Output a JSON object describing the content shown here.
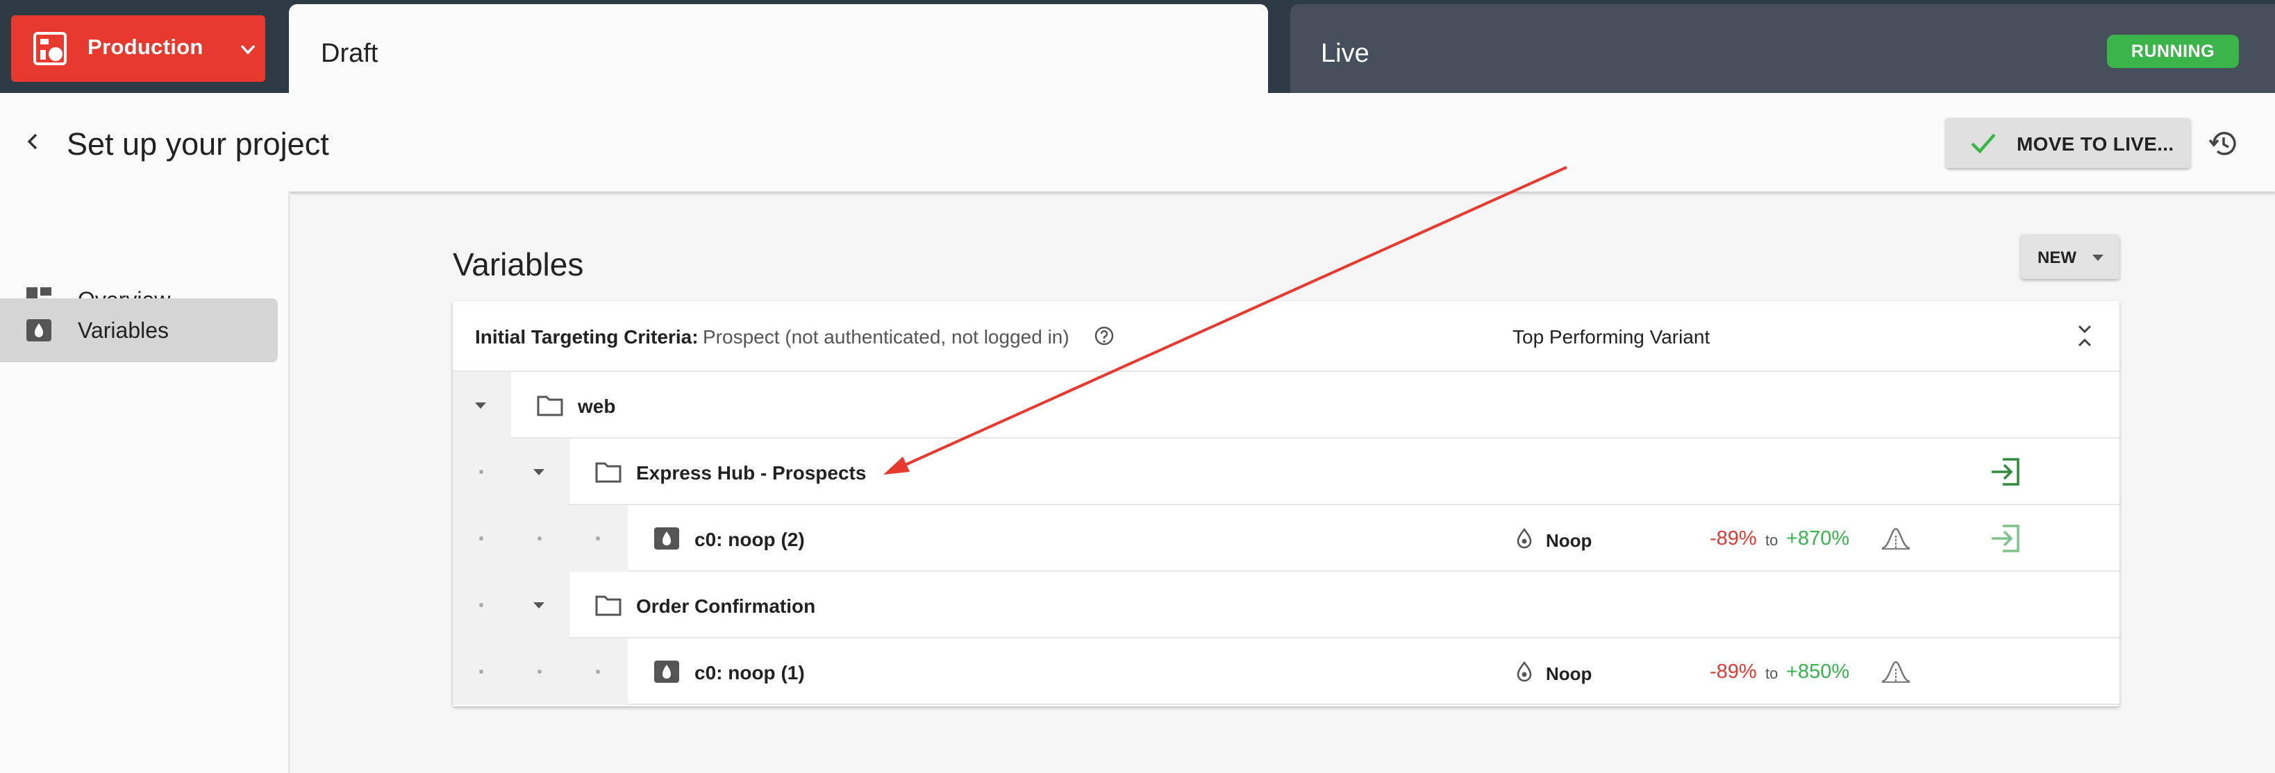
{
  "topbar": {
    "env_label": "Production",
    "draft_tab": "Draft",
    "live_tab": "Live",
    "status_badge": "RUNNING"
  },
  "header": {
    "title": "Set up your project",
    "move_button": "MOVE TO LIVE..."
  },
  "sidebar": {
    "items": [
      {
        "label": "Overview",
        "icon": "dashboard-icon"
      },
      {
        "label": "Variables",
        "icon": "variable-icon",
        "active": true
      }
    ]
  },
  "main": {
    "section_title": "Variables",
    "new_button": "NEW",
    "criteria_label": "Initial Targeting Criteria:",
    "criteria_value": "Prospect (not authenticated, not logged in)",
    "top_variant_header": "Top Performing Variant",
    "rows": [
      {
        "label": "web"
      },
      {
        "label": "Express Hub - Prospects"
      },
      {
        "label": "c0: noop (2)",
        "variant": "Noop",
        "low": "-89%",
        "to": "to",
        "high": "+870%"
      },
      {
        "label": "Order Confirmation"
      },
      {
        "label": "c0: noop (1)",
        "variant": "Noop",
        "low": "-89%",
        "to": "to",
        "high": "+850%"
      }
    ]
  },
  "colors": {
    "env_red": "#e8392f",
    "running_green": "#3bb54a",
    "negative_red": "#e0392f",
    "positive_green": "#34b54a",
    "topbar_dark": "#2f3a47"
  }
}
